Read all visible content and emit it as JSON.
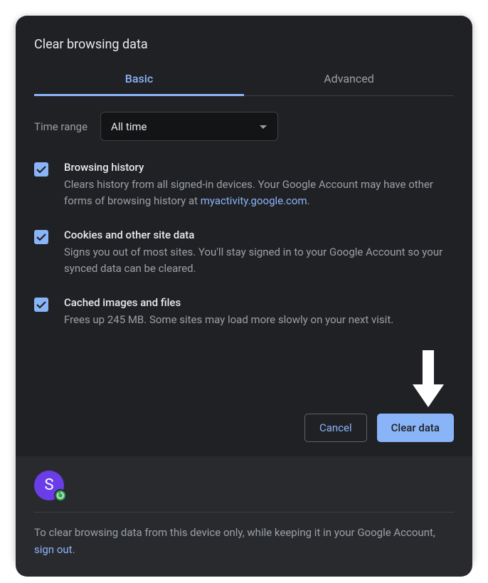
{
  "title": "Clear browsing data",
  "tabs": {
    "basic": "Basic",
    "advanced": "Advanced"
  },
  "time_range": {
    "label": "Time range",
    "value": "All time"
  },
  "options": [
    {
      "title": "Browsing history",
      "desc_pre": "Clears history from all signed-in devices. Your Google Account may have other forms of browsing history at ",
      "link": "myactivity.google.com",
      "desc_post": ".",
      "checked": true
    },
    {
      "title": "Cookies and other site data",
      "desc": "Signs you out of most sites. You'll stay signed in to your Google Account so your synced data can be cleared.",
      "checked": true
    },
    {
      "title": "Cached images and files",
      "desc": "Frees up 245 MB. Some sites may load more slowly on your next visit.",
      "checked": true
    }
  ],
  "buttons": {
    "cancel": "Cancel",
    "clear": "Clear data"
  },
  "footer": {
    "avatar_letter": "S",
    "text_pre": "To clear browsing data from this device only, while keeping it in your Google Account, ",
    "link": "sign out",
    "text_post": "."
  }
}
